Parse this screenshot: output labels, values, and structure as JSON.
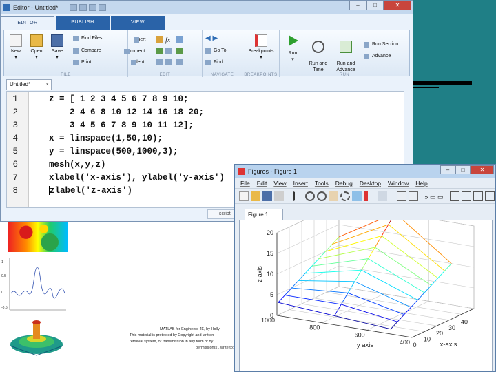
{
  "editor": {
    "title": "Editor - Untitled*",
    "window_buttons": {
      "minimize": "–",
      "maximize": "□",
      "close": "✕"
    },
    "tabs": [
      {
        "label": "EDITOR",
        "active": true
      },
      {
        "label": "PUBLISH",
        "active": false
      },
      {
        "label": "VIEW",
        "active": false
      }
    ],
    "ribbon": {
      "file": {
        "label": "FILE",
        "new": "New",
        "open": "Open",
        "save": "Save",
        "find_files": "Find Files",
        "compare": "Compare",
        "print": "Print"
      },
      "edit": {
        "label": "EDIT",
        "insert": "Insert",
        "comment": "Comment",
        "indent": "Indent",
        "fx_icon": "function-icon"
      },
      "navigate": {
        "label": "NAVIGATE",
        "go_to": "Go To",
        "find": "Find"
      },
      "breakpoints": {
        "label": "BREAKPOINTS",
        "breakpoints": "Breakpoints"
      },
      "run": {
        "label": "RUN",
        "run": "Run",
        "run_and_time": "Run and\nTime",
        "run_and_advance": "Run and\nAdvance",
        "run_section": "Run Section",
        "advance": "Advance"
      }
    },
    "file_tab": {
      "name": "Untitled*",
      "close": "×"
    },
    "code_lines": [
      {
        "num": "1",
        "text": "z = [ 1 2 3 4 5 6 7 8 9 10;"
      },
      {
        "num": "2",
        "text": "    2 4 6 8 10 12 14 16 18 20;"
      },
      {
        "num": "3",
        "text": "    3 4 5 6 7 8 9 10 11 12];"
      },
      {
        "num": "4",
        "text": "x = linspace(1,50,10);"
      },
      {
        "num": "5",
        "text": "y = linspace(500,1000,3);"
      },
      {
        "num": "6",
        "text": "mesh(x,y,z)"
      },
      {
        "num": "7",
        "text": "xlabel('x-axis'), ylabel('y-axis')"
      },
      {
        "num": "8",
        "text": "zlabel('z-axis')"
      }
    ],
    "status": "script"
  },
  "figure": {
    "title": "Figures - Figure 1",
    "window_buttons": {
      "minimize": "–",
      "maximize": "□",
      "close": "✕"
    },
    "menu": [
      "File",
      "Edit",
      "View",
      "Insert",
      "Tools",
      "Debug",
      "Desktop",
      "Window",
      "Help"
    ],
    "tab": "Figure 1",
    "plot": {
      "zlabel": "z-axis",
      "ylabel": "y axis",
      "xlabel": "x-axis",
      "z_ticks": [
        "0",
        "5",
        "10",
        "15",
        "20"
      ],
      "y_ticks": [
        "400",
        "600",
        "800",
        "1000"
      ],
      "x_ticks": [
        "0",
        "10",
        "20",
        "30",
        "40"
      ]
    }
  },
  "chart_data": {
    "type": "mesh",
    "x": [
      1,
      6.44,
      11.89,
      17.33,
      22.78,
      28.22,
      33.67,
      39.11,
      44.56,
      50
    ],
    "y": [
      500,
      750,
      1000
    ],
    "z": [
      [
        1,
        2,
        3,
        4,
        5,
        6,
        7,
        8,
        9,
        10
      ],
      [
        2,
        4,
        6,
        8,
        10,
        12,
        14,
        16,
        18,
        20
      ],
      [
        3,
        4,
        5,
        6,
        7,
        8,
        9,
        10,
        11,
        12
      ]
    ],
    "xlabel": "x-axis",
    "ylabel": "y axis",
    "zlabel": "z-axis",
    "xlim": [
      0,
      50
    ],
    "ylim": [
      400,
      1000
    ],
    "zlim": [
      0,
      20
    ],
    "grid": true
  },
  "slide": {
    "caption": [
      "MATLAB for Engineers 4E, by Holly",
      "This material is protected by Copyright and written",
      "retrieval system, or transmission in any form or by",
      "permission(s), write to: Rights and"
    ]
  }
}
